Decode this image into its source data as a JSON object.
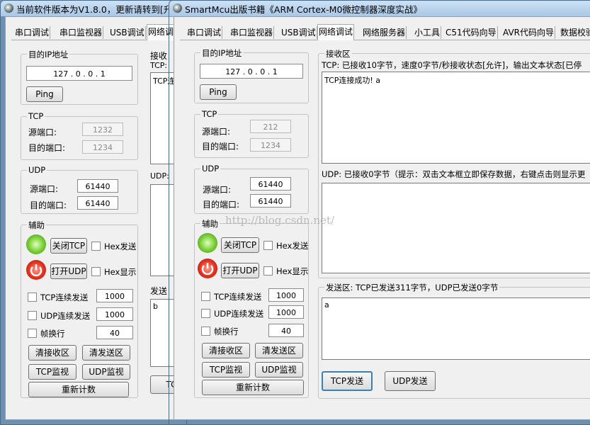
{
  "back_window": {
    "title": "当前软件版本为V1.8.0，更新请转到[升",
    "tabs": [
      "串口调试",
      "串口监视器",
      "USB调试",
      "网络调"
    ],
    "ip_group": {
      "label": "目的IP地址",
      "ip": "127  .  0  .  0  .  1",
      "ping": "Ping"
    },
    "tcp_group": {
      "label": "TCP",
      "src_label": "源端口:",
      "src_value": "1232",
      "dst_label": "目的端口:",
      "dst_value": "1234"
    },
    "udp_group": {
      "label": "UDP",
      "src_label": "源端口:",
      "src_value": "61440",
      "dst_label": "目的端口:",
      "dst_value": "61440"
    },
    "aux_group": {
      "label": "辅助",
      "close_tcp": "关闭TCP",
      "hex_send": "Hex发送",
      "open_udp": "打开UDP",
      "hex_show": "Hex显示",
      "tcp_cont": "TCP连续发送",
      "tcp_cont_val": "1000",
      "udp_cont": "UDP连续发送",
      "udp_cont_val": "1000",
      "frame_break": "帧换行",
      "frame_val": "40",
      "clear_recv": "清接收区",
      "clear_send": "清发送区",
      "tcp_mon": "TCP监视",
      "udp_mon": "UDP监视",
      "recount": "重新计数"
    },
    "recv_label": "接收",
    "tcp_line": "TCP:",
    "tcp_content": "TCP连",
    "udp_line": "UDP:",
    "send_label": "发送",
    "send_content": "b",
    "tc_btn": "TC"
  },
  "front_window": {
    "title": "SmartMcu出版书籍《ARM Cortex-M0微控制器深度实战》",
    "tabs": [
      "串口调试",
      "串口监视器",
      "USB调试",
      "网络调试",
      "网络服务器",
      "小工具",
      "C51代码向导",
      "AVR代码向导",
      "数据校验"
    ],
    "ip_group": {
      "label": "目的IP地址",
      "ip": "127  .  0  .  0  .  1",
      "ping": "Ping"
    },
    "tcp_group": {
      "label": "TCP",
      "src_label": "源端口:",
      "src_value": "212",
      "dst_label": "目的端口:",
      "dst_value": "1234"
    },
    "udp_group": {
      "label": "UDP",
      "src_label": "源端口:",
      "src_value": "61440",
      "dst_label": "目的端口:",
      "dst_value": "61440"
    },
    "aux_group": {
      "label": "辅助",
      "close_tcp": "关闭TCP",
      "hex_send": "Hex发送",
      "open_udp": "打开UDP",
      "hex_show": "Hex显示",
      "tcp_cont": "TCP连续发送",
      "tcp_cont_val": "1000",
      "udp_cont": "UDP连续发送",
      "udp_cont_val": "1000",
      "frame_break": "帧换行",
      "frame_val": "40",
      "clear_recv": "清接收区",
      "clear_send": "清发送区",
      "tcp_mon": "TCP监视",
      "udp_mon": "UDP监视",
      "recount": "重新计数"
    },
    "recv_group_label": "接收区",
    "tcp_status": "TCP: 已接收10字节，速度0字节/秒接收状态[允许]，输出文本状态[已停",
    "tcp_content": "TCP连接成功! a",
    "udp_status": "UDP: 已接收0字节（提示：双击文本框立即保存数据，右键点击则显示更",
    "send_group_label": "发送区: TCP已发送311字节，UDP已发送0字节",
    "send_content": "a",
    "tcp_send": "TCP发送",
    "udp_send": "UDP发送"
  },
  "watermark": "http://blog.csdn.net/",
  "colors": {
    "titlebar": "#b5d0ec",
    "face": "#f0f0f0",
    "desktop": "#6d8fb0"
  }
}
